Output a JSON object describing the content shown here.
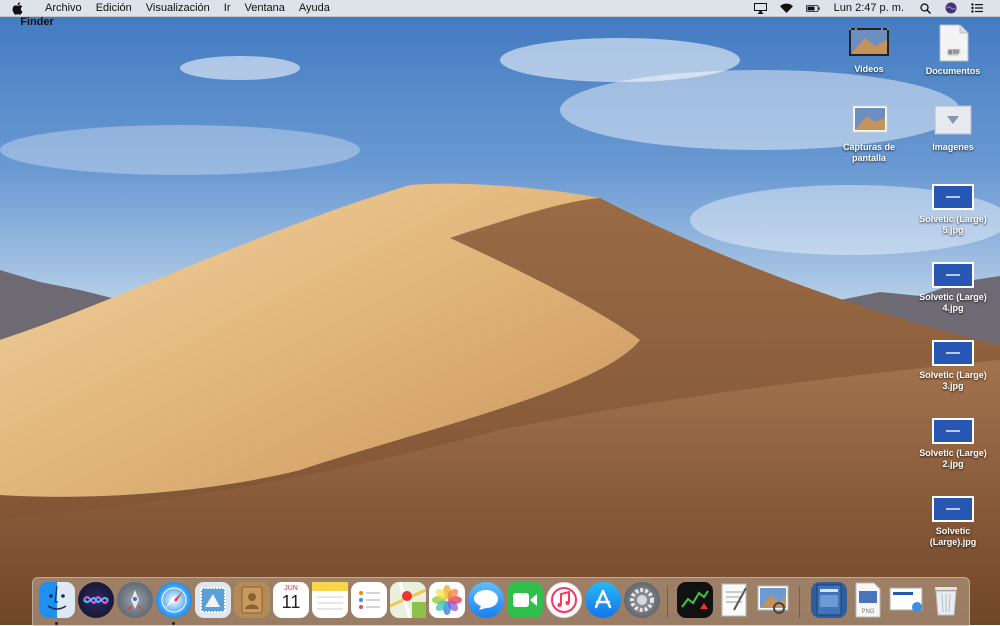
{
  "menubar": {
    "app_name": "Finder",
    "menus": [
      "Archivo",
      "Edición",
      "Visualización",
      "Ir",
      "Ventana",
      "Ayuda"
    ],
    "clock": "Lun 2:47 p. m."
  },
  "desktop_icons": [
    {
      "label": "Videos",
      "icon": "video-thumbnail-icon"
    },
    {
      "label": "Documentos",
      "icon": "rtf-document-icon",
      "badge": "RTF"
    },
    {
      "label": "Capturas de pantalla",
      "icon": "screenshot-folder-icon"
    },
    {
      "label": "Imagenes",
      "icon": "image-folder-icon"
    },
    {
      "label": "Solvetic (Large) 5.jpg",
      "icon": "jpg-thumbnail-icon"
    },
    {
      "label": "Solvetic (Large) 4.jpg",
      "icon": "jpg-thumbnail-icon"
    },
    {
      "label": "Solvetic (Large) 3.jpg",
      "icon": "jpg-thumbnail-icon"
    },
    {
      "label": "Solvetic (Large) 2.jpg",
      "icon": "jpg-thumbnail-icon"
    },
    {
      "label": "Solvetic (Large).jpg",
      "icon": "jpg-thumbnail-icon"
    }
  ],
  "dock": {
    "calendar_month": "JUN",
    "calendar_day": "11",
    "preview_badge": "PNG",
    "apps": [
      "finder-icon",
      "siri-icon",
      "launchpad-icon",
      "safari-icon",
      "mail-icon",
      "contacts-icon",
      "calendar-icon",
      "notes-icon",
      "reminders-icon",
      "maps-icon",
      "photos-icon",
      "messages-icon",
      "facetime-icon",
      "itunes-icon",
      "app-store-icon",
      "system-preferences-icon",
      "stocks-icon",
      "textedit-icon",
      "preview-icon",
      "document-icon",
      "png-file-icon",
      "screenshot-icon",
      "trash-icon"
    ]
  }
}
